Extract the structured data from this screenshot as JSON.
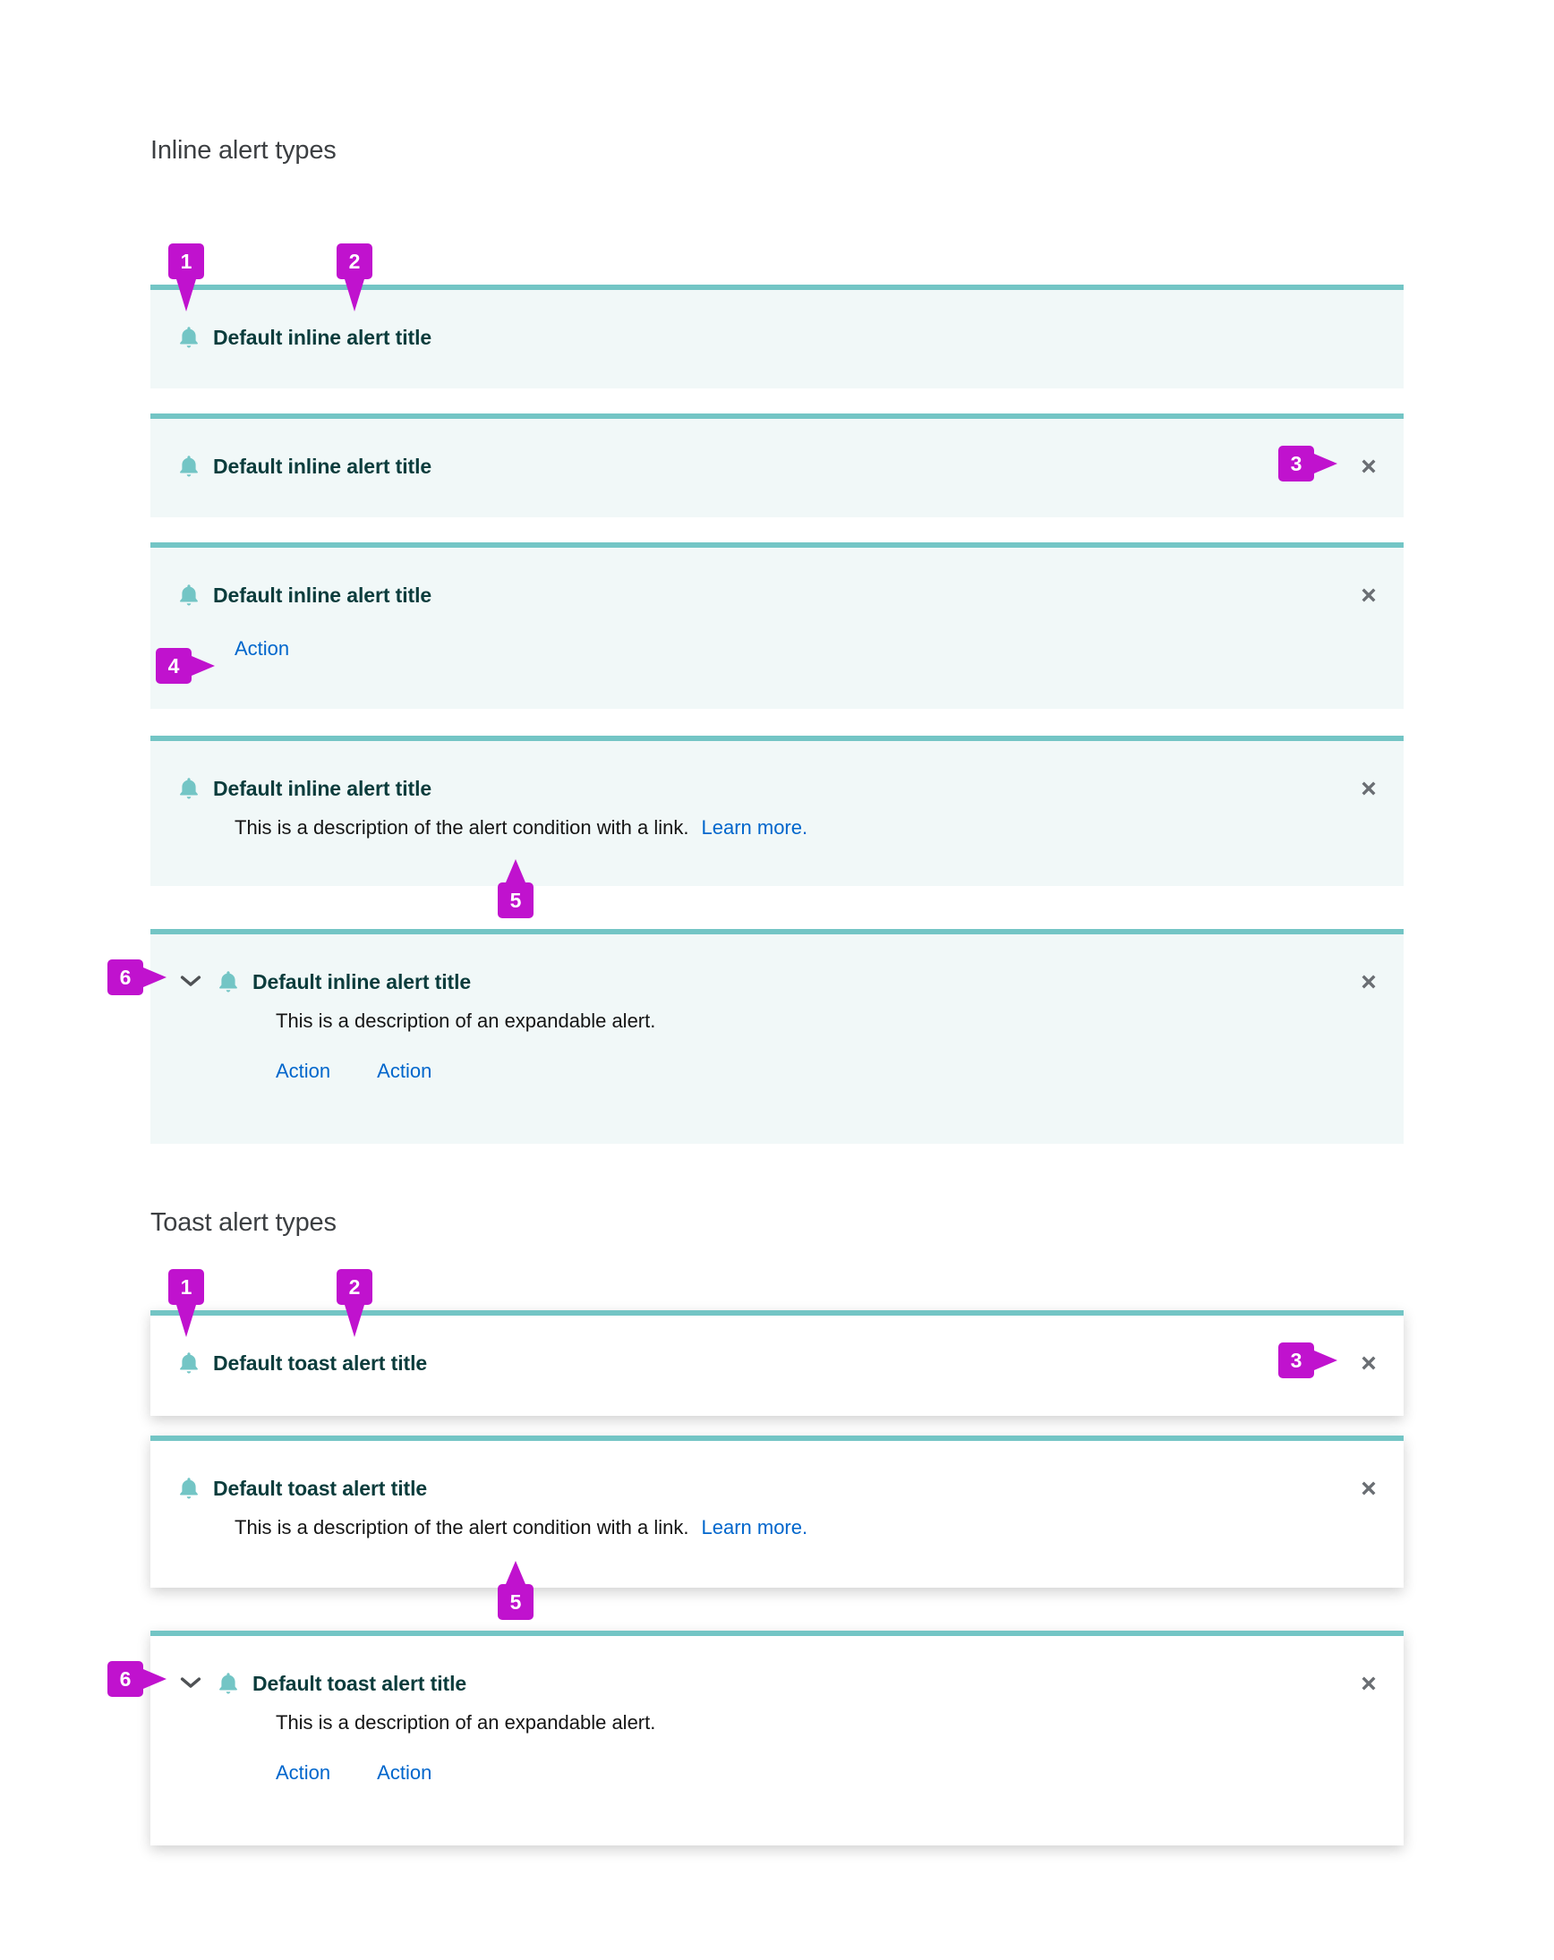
{
  "sections": {
    "inline": {
      "heading": "Inline alert types"
    },
    "toast": {
      "heading": "Toast alert types"
    }
  },
  "labels": {
    "inline_title": "Default inline alert title",
    "toast_title": "Default toast alert title",
    "condition_description": "This is a description of the alert condition with a link.",
    "learn_more": "Learn more.",
    "expandable_description": "This is a description of an expandable alert.",
    "action": "Action"
  },
  "callouts": {
    "one": "1",
    "two": "2",
    "three": "3",
    "four": "4",
    "five": "5",
    "six": "6"
  },
  "icons": {
    "bell": "bell-icon",
    "close": "close-icon",
    "chevron": "chevron-down-icon"
  },
  "colors": {
    "accent_teal": "#73c5c5",
    "inline_background": "#f1f8f8",
    "toast_background": "#ffffff",
    "title_text": "#0b3c3c",
    "body_text": "#151515",
    "link": "#0066cc",
    "close_icon": "#6a6e73",
    "callout_magenta": "#c012ce",
    "heading_text": "#3c3f42"
  },
  "inline_alerts": [
    {
      "title": "Default inline alert title",
      "closable": false,
      "actions": [],
      "description": null,
      "expandable": false
    },
    {
      "title": "Default inline alert title",
      "closable": true,
      "actions": [],
      "description": null,
      "expandable": false
    },
    {
      "title": "Default inline alert title",
      "closable": true,
      "actions": [
        "Action"
      ],
      "description": null,
      "expandable": false
    },
    {
      "title": "Default inline alert title",
      "closable": true,
      "actions": [],
      "description": "This is a description of the alert condition with a link.",
      "link": "Learn more.",
      "expandable": false
    },
    {
      "title": "Default inline alert title",
      "closable": true,
      "actions": [
        "Action",
        "Action"
      ],
      "description": "This is a description of an expandable alert.",
      "expandable": true
    }
  ],
  "toast_alerts": [
    {
      "title": "Default toast alert title",
      "closable": true,
      "actions": [],
      "description": null,
      "expandable": false
    },
    {
      "title": "Default toast alert title",
      "closable": true,
      "actions": [],
      "description": "This is a description of the alert condition with a link.",
      "link": "Learn more.",
      "expandable": false
    },
    {
      "title": "Default toast alert title",
      "closable": true,
      "actions": [
        "Action",
        "Action"
      ],
      "description": "This is a description of an expandable alert.",
      "expandable": true
    }
  ]
}
